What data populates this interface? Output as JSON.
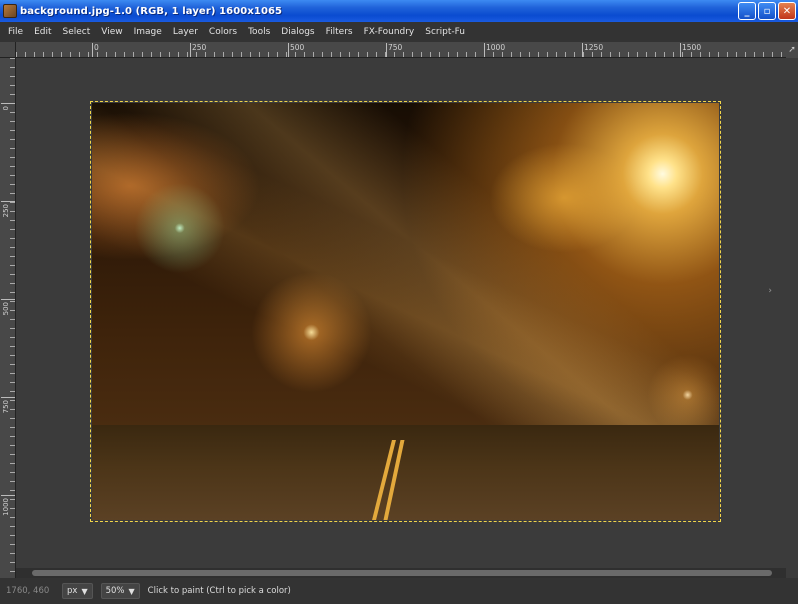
{
  "window": {
    "title": "background.jpg-1.0 (RGB, 1 layer) 1600x1065",
    "minimize_glyph": "_",
    "maximize_glyph": "▫",
    "close_glyph": "✕"
  },
  "menu": [
    "File",
    "Edit",
    "Select",
    "View",
    "Image",
    "Layer",
    "Colors",
    "Tools",
    "Dialogs",
    "Filters",
    "FX-Foundry",
    "Script-Fu"
  ],
  "ruler_top": [
    "0",
    "250",
    "500",
    "750",
    "1000",
    "1250",
    "1500"
  ],
  "ruler_left": [
    "0",
    "250",
    "500",
    "750",
    "1000"
  ],
  "status": {
    "coords": "1760, 460",
    "unit": "px",
    "zoom": "50%",
    "message": "Click to paint (Ctrl to pick a color)"
  },
  "colors": {
    "title_bar": "#1f62d9",
    "canvas_bg": "#3b3b3b",
    "selection_marquee": "#f2d64a"
  },
  "icons": {
    "app": "gimp-icon",
    "nav": "navigate-icon"
  }
}
